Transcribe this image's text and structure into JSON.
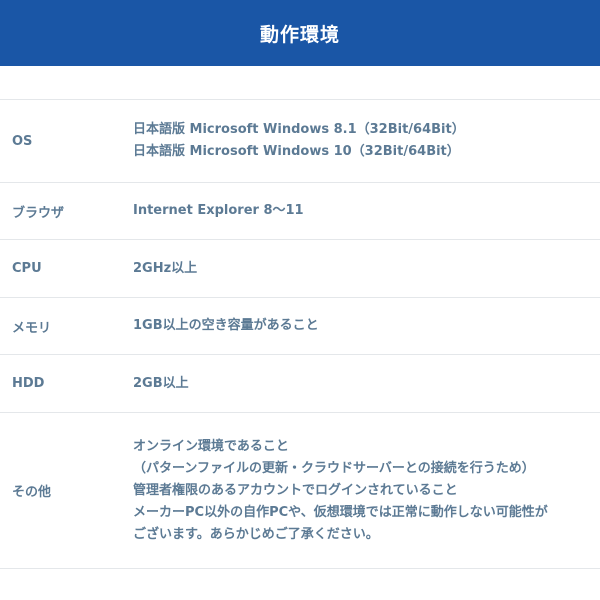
{
  "header": {
    "title": "動作環境"
  },
  "rows": [
    {
      "label": "OS",
      "lines": [
        "日本語版 Microsoft Windows 8.1（32Bit/64Bit）",
        "日本語版 Microsoft Windows 10（32Bit/64Bit）"
      ]
    },
    {
      "label": "ブラウザ",
      "lines": [
        "Internet Explorer 8〜11"
      ]
    },
    {
      "label": "CPU",
      "lines": [
        "2GHz以上"
      ]
    },
    {
      "label": "メモリ",
      "lines": [
        "1GB以上の空き容量があること"
      ]
    },
    {
      "label": "HDD",
      "lines": [
        "2GB以上"
      ]
    },
    {
      "label": "その他",
      "lines": [
        "オンライン環境であること",
        "（パターンファイルの更新・クラウドサーバーとの接続を行うため）",
        "管理者権限のあるアカウントでログインされていること",
        "メーカーPC以外の自作PCや、仮想環境では正常に動作しない可能性が",
        "ございます。あらかじめご了承ください。"
      ]
    }
  ]
}
